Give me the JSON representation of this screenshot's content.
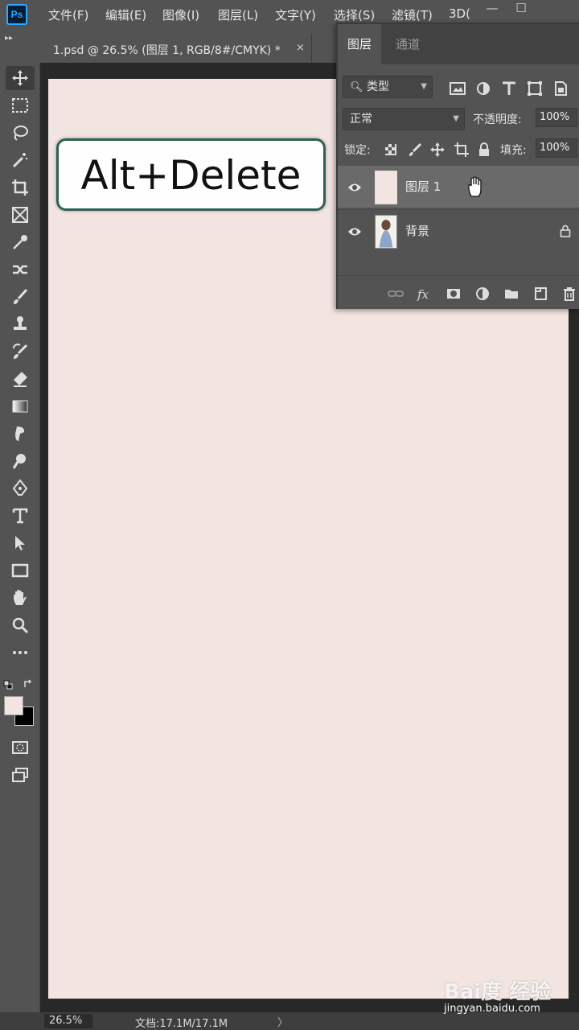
{
  "app": {
    "logo": "Ps",
    "menu": [
      "文件(F)",
      "编辑(E)",
      "图像(I)",
      "图层(L)",
      "文字(Y)",
      "选择(S)",
      "滤镜(T)",
      "3D("
    ],
    "window_controls": {
      "minimize": "—",
      "maximize": "☐"
    }
  },
  "document_tab": {
    "label": "1.psd @ 26.5% (图层 1, RGB/8#/CMYK) *",
    "close": "×"
  },
  "canvas": {
    "background_color": "#f2e4e1",
    "shortcut_overlay": "Alt+Delete"
  },
  "toolbar": {
    "tools": [
      "move-tool",
      "marquee-tool",
      "lasso-tool",
      "magic-wand-tool",
      "crop-tool",
      "frame-tool",
      "eyedropper-tool",
      "healing-tool",
      "brush-tool",
      "stamp-tool",
      "history-brush-tool",
      "eraser-tool",
      "gradient-tool",
      "smudge-tool",
      "dodge-tool",
      "pen-tool",
      "type-tool",
      "path-selection-tool",
      "rectangle-tool",
      "hand-tool",
      "zoom-tool",
      "more-tools"
    ],
    "foreground_color": "#f2e4e1",
    "background_color": "#000000"
  },
  "layers_panel": {
    "tabs": [
      "图层",
      "通道"
    ],
    "filter": {
      "label": "类型"
    },
    "blend_mode": "正常",
    "opacity_label": "不透明度:",
    "opacity_value": "100%",
    "lock_label": "锁定:",
    "fill_label": "填充:",
    "fill_value": "100%",
    "layers": [
      {
        "name": "图层 1",
        "visible": true,
        "thumb_color": "#f2e4e1",
        "selected": true
      },
      {
        "name": "背景",
        "visible": true,
        "locked": true
      }
    ]
  },
  "statusbar": {
    "zoom": "26.5%",
    "doc_info": "文档:17.1M/17.1M",
    "arrow": "〉"
  },
  "watermark": {
    "logo": "Bai度 经验",
    "url": "jingyan.baidu.com"
  }
}
